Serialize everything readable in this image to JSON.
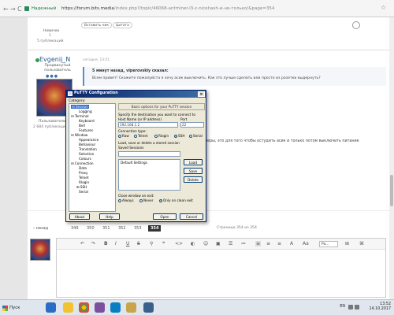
{
  "browser": {
    "nav_back": "←",
    "nav_forward": "→",
    "nav_reload": "C",
    "secure_label": "Надежный",
    "url_host": "https://forum.bits.media",
    "url_path": "/index.php?/topic/46068-antminer-l3-c-nicehash-и-не-только/&page=354",
    "star": "☆"
  },
  "post1": {
    "role": "Новичок",
    "rank": "1",
    "posts": "5 публикаций",
    "quote_button": "Вставить ник",
    "cite_button": "Цитата"
  },
  "post2": {
    "username": "Evgenij_N",
    "role": "Продвинутый пользователь",
    "dots": "●●●",
    "group": "Пользователи",
    "rank": "264",
    "posts": "2 684 публикации",
    "time": "сегодня, 13:51",
    "quote_head": "5 минут назад, viperovskiy сказал:",
    "quote_text": "Всем привет! Скажите пожалуйста я хочу асик выключить. Как это лучше сделать или просто из разетки выдернуть?",
    "body_text": "ллеры, это для того чтобы остудить асик и только потом выключить питание"
  },
  "pager": {
    "prev": "назад",
    "pages": [
      "349",
      "350",
      "351",
      "352",
      "353",
      "354"
    ],
    "active_page": "354",
    "info": "Страница 354 из 354"
  },
  "editor": {
    "format_select": "Ра..."
  },
  "putty": {
    "title": "PuTTY Configuration",
    "close": "×",
    "category_label": "Category:",
    "tree": [
      {
        "label": "⊟ Session",
        "selected": true
      },
      {
        "label": "Logging"
      },
      {
        "label": "⊟ Terminal"
      },
      {
        "label": "Keyboard"
      },
      {
        "label": "Bell"
      },
      {
        "label": "Features"
      },
      {
        "label": "⊟ Window"
      },
      {
        "label": "Appearance"
      },
      {
        "label": "Behaviour"
      },
      {
        "label": "Translation"
      },
      {
        "label": "Selection"
      },
      {
        "label": "Colours"
      },
      {
        "label": "⊟ Connection"
      },
      {
        "label": "Data"
      },
      {
        "label": "Proxy"
      },
      {
        "label": "Telnet"
      },
      {
        "label": "Rlogin"
      },
      {
        "label": "⊞ SSH"
      },
      {
        "label": "Serial"
      }
    ],
    "basic_options": "Basic options for your PuTTY session",
    "specify_dest": "Specify the destination you want to connect to",
    "host_label": "Host Name (or IP address)",
    "port_label": "Port",
    "host_value": "192.168.1.2",
    "port_value": "22",
    "conn_type_label": "Connection type:",
    "conn_types": [
      "Raw",
      "Telnet",
      "Rlogin",
      "SSH",
      "Serial"
    ],
    "selected_conn_type": "SSH",
    "load_save_label": "Load, save or delete a stored session",
    "saved_sessions_label": "Saved Sessions",
    "saved_session_value": "",
    "sessions": [
      "Default Settings"
    ],
    "load_button": "Load",
    "save_button": "Save",
    "delete_button": "Delete",
    "close_window_label": "Close window on exit:",
    "close_options": [
      "Always",
      "Never",
      "Only on clean exit"
    ],
    "selected_close_option": "Only on clean exit",
    "about_button": "About",
    "help_button": "Help",
    "open_button": "Open",
    "cancel_button": "Cancel"
  },
  "taskbar": {
    "start_label": "Пуск",
    "lang": "EN",
    "time": "13:52",
    "date": "14.10.2017"
  }
}
